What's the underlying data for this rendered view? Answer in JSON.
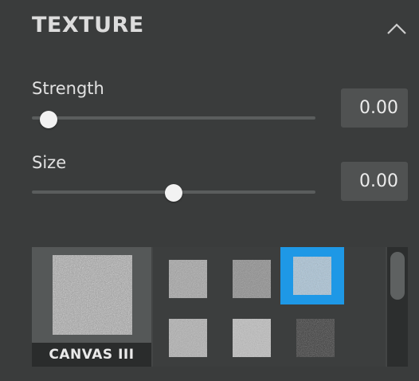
{
  "section": {
    "title": "TEXTURE"
  },
  "controls": {
    "strength": {
      "label": "Strength",
      "value": "0.00",
      "level": 0.0
    },
    "size": {
      "label": "Size",
      "value": "0.00",
      "level": 0.5
    }
  },
  "texture_browser": {
    "preview_name": "CANVAS III",
    "swatches": [
      "canvas-swatch-1",
      "canvas-swatch-2",
      "canvas-swatch-3-selected",
      "canvas-swatch-4",
      "canvas-swatch-5",
      "canvas-swatch-6"
    ],
    "selected_color": "#1e98e6"
  }
}
